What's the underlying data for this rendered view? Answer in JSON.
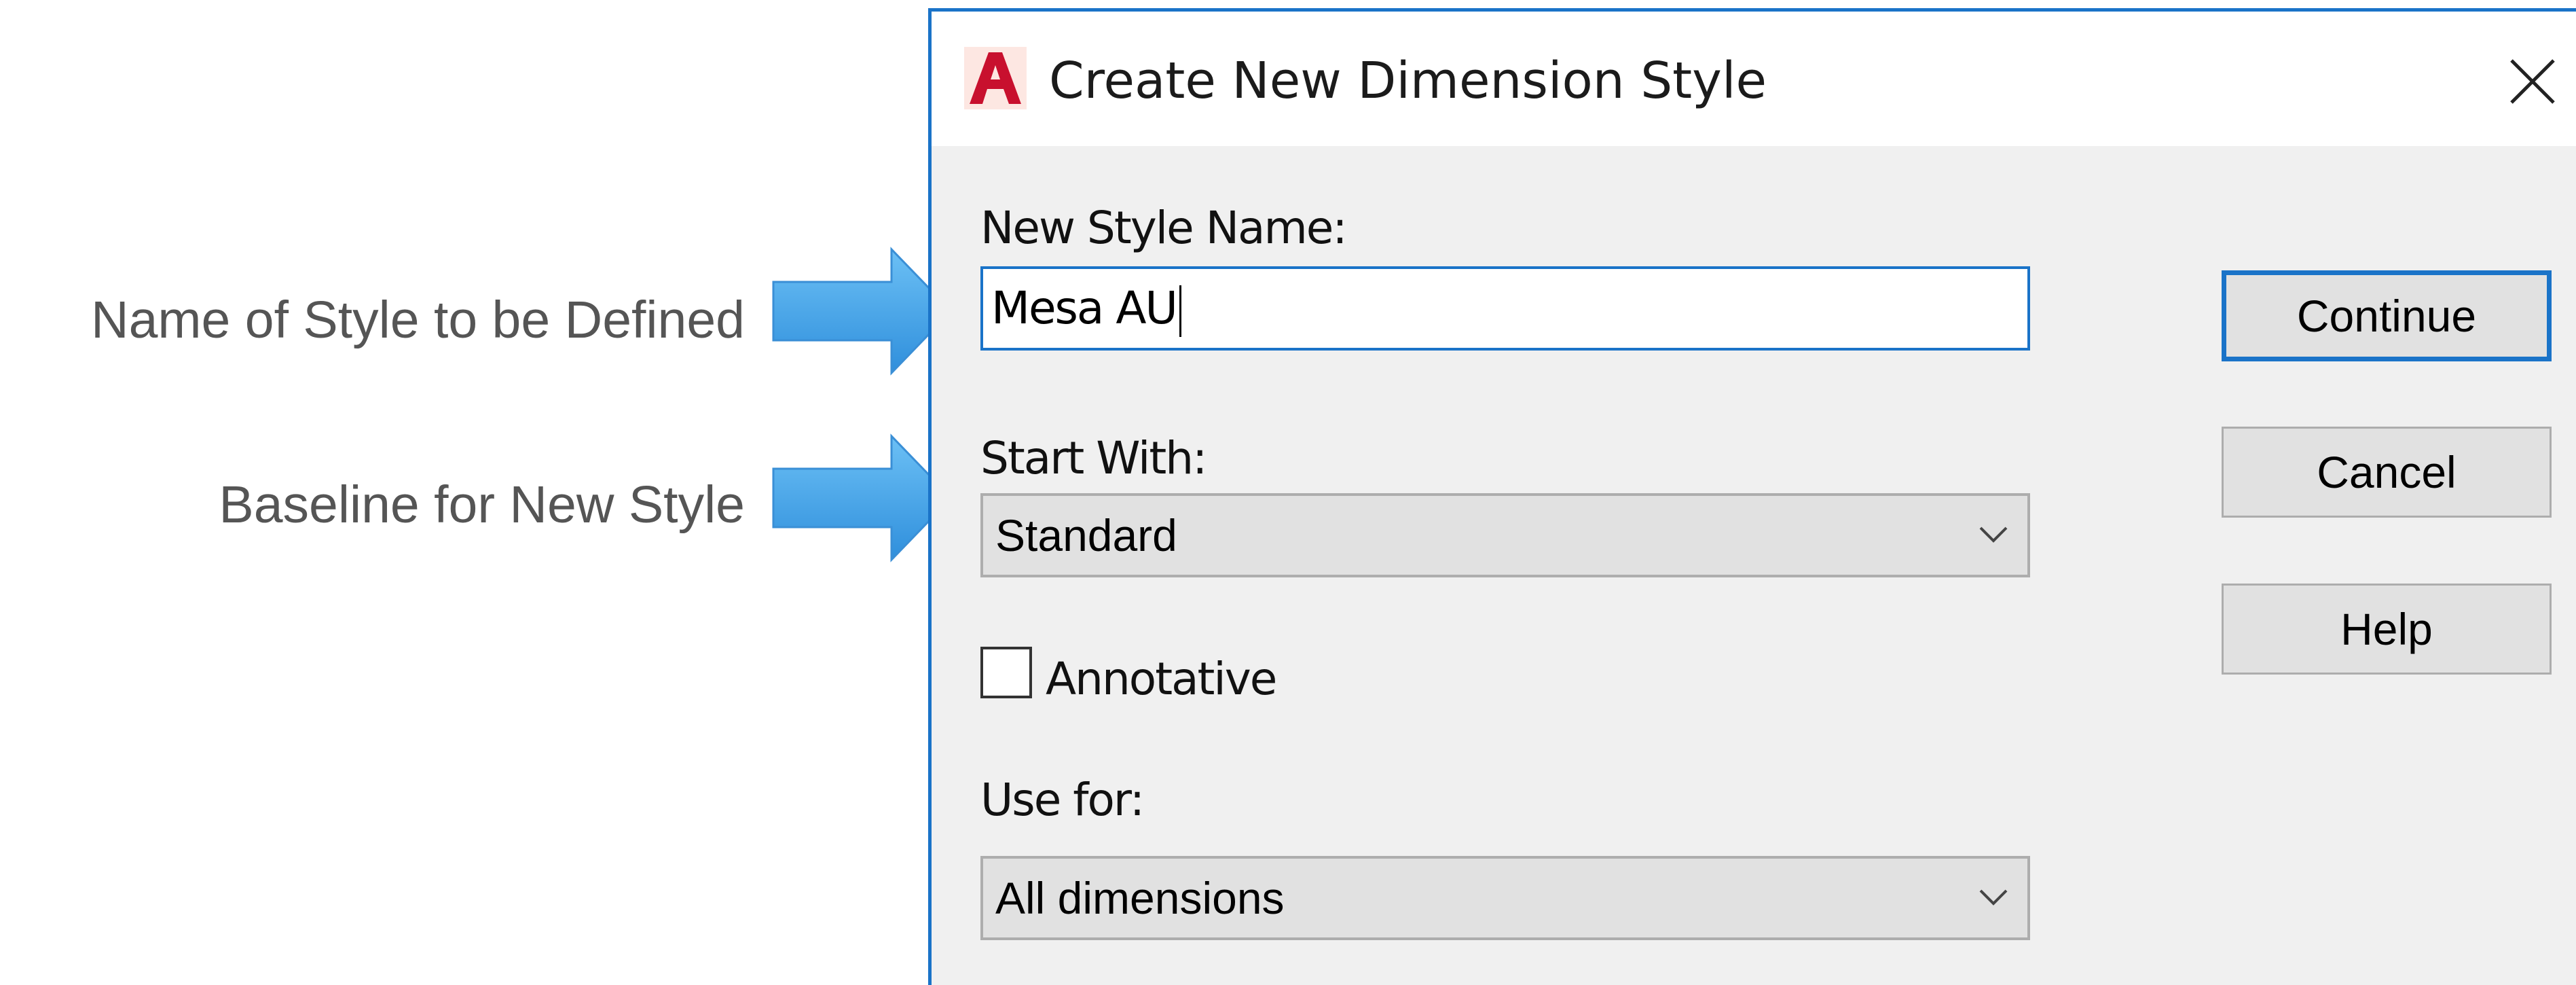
{
  "annotations": [
    {
      "text": "Name of Style to be Defined",
      "color": "#4fa7ea"
    },
    {
      "text": "Baseline for New Style",
      "color": "#4fa7ea"
    }
  ],
  "dialog": {
    "title": "Create New Dimension Style",
    "icon": "autocad-logo-icon",
    "accent_color": "#1a73c8",
    "new_style_name": {
      "label": "New Style Name:",
      "value": "Mesa AU"
    },
    "start_with": {
      "label": "Start With:",
      "value": "Standard"
    },
    "annotative": {
      "label": "Annotative",
      "checked": false
    },
    "use_for": {
      "label": "Use for:",
      "value": "All dimensions"
    },
    "buttons": {
      "continue": "Continue",
      "cancel": "Cancel",
      "help": "Help"
    }
  }
}
